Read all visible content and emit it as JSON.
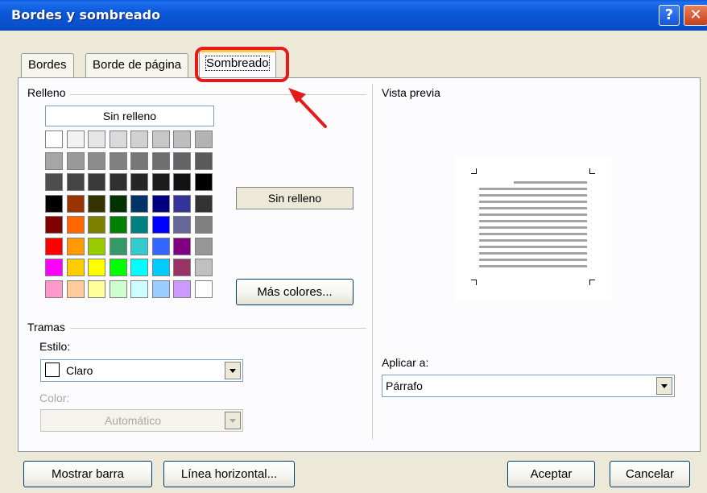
{
  "window": {
    "title": "Bordes y sombreado"
  },
  "titlebar": {
    "help_icon": "question-icon",
    "close_icon": "close-icon"
  },
  "tabs": [
    {
      "label": "Bordes"
    },
    {
      "label": "Borde de página"
    },
    {
      "label": "Sombreado",
      "active": true
    }
  ],
  "fill": {
    "group_label": "Relleno",
    "no_fill_label": "Sin relleno",
    "selected_label": "Sin relleno",
    "more_colors_label": "Más colores...",
    "palette": [
      [
        "#ffffff",
        "#f2f2f2",
        "#e6e6e6",
        "#dadada",
        "#d0d0d0",
        "#c7c7c7",
        "#bebebe",
        "#b3b3b3"
      ],
      [
        "#a6a6a6",
        "#999999",
        "#8c8c8c",
        "#808080",
        "#777777",
        "#6e6e6e",
        "#646464",
        "#5a5a5a"
      ],
      [
        "#4d4d4d",
        "#444444",
        "#3a3a3a",
        "#2f2f2f",
        "#262626",
        "#1c1c1c",
        "#121212",
        "#000000"
      ],
      [
        "#000000",
        "#993300",
        "#333300",
        "#003300",
        "#003366",
        "#000080",
        "#333399",
        "#333333"
      ],
      [
        "#800000",
        "#ff6600",
        "#808000",
        "#008000",
        "#008080",
        "#0000ff",
        "#666699",
        "#808080"
      ],
      [
        "#ff0000",
        "#ff9900",
        "#99cc00",
        "#339966",
        "#33cccc",
        "#3366ff",
        "#800080",
        "#969696"
      ],
      [
        "#ff00ff",
        "#ffcc00",
        "#ffff00",
        "#00ff00",
        "#00ffff",
        "#00ccff",
        "#993366",
        "#c0c0c0"
      ],
      [
        "#ff99cc",
        "#ffcc99",
        "#ffff99",
        "#ccffcc",
        "#ccffff",
        "#99ccff",
        "#cc99ff",
        "#ffffff"
      ]
    ]
  },
  "patterns": {
    "group_label": "Tramas",
    "style_label": "Estilo:",
    "style_value": "Claro",
    "color_label": "Color:",
    "color_value": "Automático"
  },
  "preview": {
    "label": "Vista previa",
    "apply_label": "Aplicar a:",
    "apply_value": "Párrafo"
  },
  "footer": {
    "show_toolbar_label": "Mostrar barra",
    "horizontal_line_label": "Línea horizontal...",
    "ok_label": "Aceptar",
    "cancel_label": "Cancelar"
  },
  "annotation": {
    "color": "#e41b1b"
  }
}
